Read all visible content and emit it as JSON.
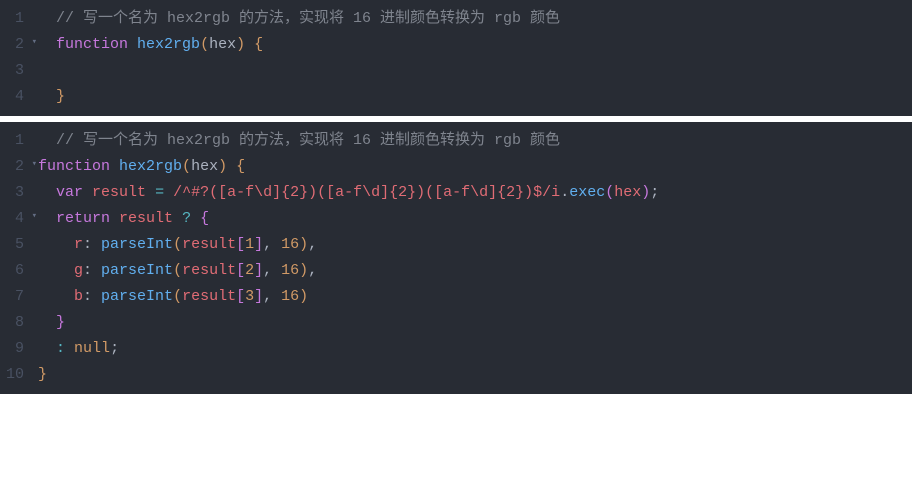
{
  "editor_top": {
    "lines": [
      {
        "num": "1",
        "fold": false,
        "segments": [
          {
            "cls": "cmt",
            "t": "  // 写一个名为 hex2rgb 的方法，实现将 16 进制颜色转换为 rgb 颜色"
          }
        ]
      },
      {
        "num": "2",
        "fold": true,
        "segments": [
          {
            "cls": "",
            "t": "  "
          },
          {
            "cls": "kw",
            "t": "function"
          },
          {
            "cls": "",
            "t": " "
          },
          {
            "cls": "fn",
            "t": "hex2rgb"
          },
          {
            "cls": "brc",
            "t": "("
          },
          {
            "cls": "prm",
            "t": "hex"
          },
          {
            "cls": "brc",
            "t": ")"
          },
          {
            "cls": "",
            "t": " "
          },
          {
            "cls": "brc",
            "t": "{"
          }
        ]
      },
      {
        "num": "3",
        "fold": false,
        "segments": [
          {
            "cls": "",
            "t": "  "
          }
        ]
      },
      {
        "num": "4",
        "fold": false,
        "segments": [
          {
            "cls": "",
            "t": "  "
          },
          {
            "cls": "brc",
            "t": "}"
          }
        ]
      }
    ]
  },
  "editor_bottom": {
    "lines": [
      {
        "num": "1",
        "fold": false,
        "segments": [
          {
            "cls": "cmt",
            "t": "  // 写一个名为 hex2rgb 的方法，实现将 16 进制颜色转换为 rgb 颜色"
          }
        ]
      },
      {
        "num": "2",
        "fold": true,
        "segments": [
          {
            "cls": "kw",
            "t": "function"
          },
          {
            "cls": "",
            "t": " "
          },
          {
            "cls": "fn",
            "t": "hex2rgb"
          },
          {
            "cls": "brc",
            "t": "("
          },
          {
            "cls": "prm",
            "t": "hex"
          },
          {
            "cls": "brc",
            "t": ")"
          },
          {
            "cls": "",
            "t": " "
          },
          {
            "cls": "brc",
            "t": "{"
          }
        ]
      },
      {
        "num": "3",
        "fold": false,
        "segments": [
          {
            "cls": "",
            "t": "  "
          },
          {
            "cls": "kw",
            "t": "var"
          },
          {
            "cls": "",
            "t": " "
          },
          {
            "cls": "var",
            "t": "result"
          },
          {
            "cls": "",
            "t": " "
          },
          {
            "cls": "op",
            "t": "="
          },
          {
            "cls": "",
            "t": " "
          },
          {
            "cls": "re",
            "t": "/^#?([a-f\\d]{2})([a-f\\d]{2})([a-f\\d]{2})$/i"
          },
          {
            "cls": "pun",
            "t": "."
          },
          {
            "cls": "fn",
            "t": "exec"
          },
          {
            "cls": "brc2",
            "t": "("
          },
          {
            "cls": "var",
            "t": "hex"
          },
          {
            "cls": "brc2",
            "t": ")"
          },
          {
            "cls": "pun",
            "t": ";"
          }
        ]
      },
      {
        "num": "4",
        "fold": true,
        "segments": [
          {
            "cls": "",
            "t": "  "
          },
          {
            "cls": "kw",
            "t": "return"
          },
          {
            "cls": "",
            "t": " "
          },
          {
            "cls": "var",
            "t": "result"
          },
          {
            "cls": "",
            "t": " "
          },
          {
            "cls": "op",
            "t": "?"
          },
          {
            "cls": "",
            "t": " "
          },
          {
            "cls": "brc2",
            "t": "{"
          }
        ]
      },
      {
        "num": "5",
        "fold": false,
        "segments": [
          {
            "cls": "",
            "t": "    "
          },
          {
            "cls": "prop",
            "t": "r"
          },
          {
            "cls": "pun",
            "t": ": "
          },
          {
            "cls": "fn",
            "t": "parseInt"
          },
          {
            "cls": "brc",
            "t": "("
          },
          {
            "cls": "var",
            "t": "result"
          },
          {
            "cls": "brc2",
            "t": "["
          },
          {
            "cls": "num",
            "t": "1"
          },
          {
            "cls": "brc2",
            "t": "]"
          },
          {
            "cls": "pun",
            "t": ", "
          },
          {
            "cls": "num",
            "t": "16"
          },
          {
            "cls": "brc",
            "t": ")"
          },
          {
            "cls": "pun",
            "t": ","
          }
        ]
      },
      {
        "num": "6",
        "fold": false,
        "segments": [
          {
            "cls": "",
            "t": "    "
          },
          {
            "cls": "prop",
            "t": "g"
          },
          {
            "cls": "pun",
            "t": ": "
          },
          {
            "cls": "fn",
            "t": "parseInt"
          },
          {
            "cls": "brc",
            "t": "("
          },
          {
            "cls": "var",
            "t": "result"
          },
          {
            "cls": "brc2",
            "t": "["
          },
          {
            "cls": "num",
            "t": "2"
          },
          {
            "cls": "brc2",
            "t": "]"
          },
          {
            "cls": "pun",
            "t": ", "
          },
          {
            "cls": "num",
            "t": "16"
          },
          {
            "cls": "brc",
            "t": ")"
          },
          {
            "cls": "pun",
            "t": ","
          }
        ]
      },
      {
        "num": "7",
        "fold": false,
        "segments": [
          {
            "cls": "",
            "t": "    "
          },
          {
            "cls": "prop",
            "t": "b"
          },
          {
            "cls": "pun",
            "t": ": "
          },
          {
            "cls": "fn",
            "t": "parseInt"
          },
          {
            "cls": "brc",
            "t": "("
          },
          {
            "cls": "var",
            "t": "result"
          },
          {
            "cls": "brc2",
            "t": "["
          },
          {
            "cls": "num",
            "t": "3"
          },
          {
            "cls": "brc2",
            "t": "]"
          },
          {
            "cls": "pun",
            "t": ", "
          },
          {
            "cls": "num",
            "t": "16"
          },
          {
            "cls": "brc",
            "t": ")"
          }
        ]
      },
      {
        "num": "8",
        "fold": false,
        "segments": [
          {
            "cls": "",
            "t": "  "
          },
          {
            "cls": "brc2",
            "t": "}"
          }
        ]
      },
      {
        "num": "9",
        "fold": false,
        "segments": [
          {
            "cls": "",
            "t": "  "
          },
          {
            "cls": "op",
            "t": ":"
          },
          {
            "cls": "",
            "t": " "
          },
          {
            "cls": "null",
            "t": "null"
          },
          {
            "cls": "pun",
            "t": ";"
          }
        ]
      },
      {
        "num": "10",
        "fold": false,
        "segments": [
          {
            "cls": "brc",
            "t": "}"
          }
        ]
      }
    ]
  },
  "fold_glyph": "▾"
}
